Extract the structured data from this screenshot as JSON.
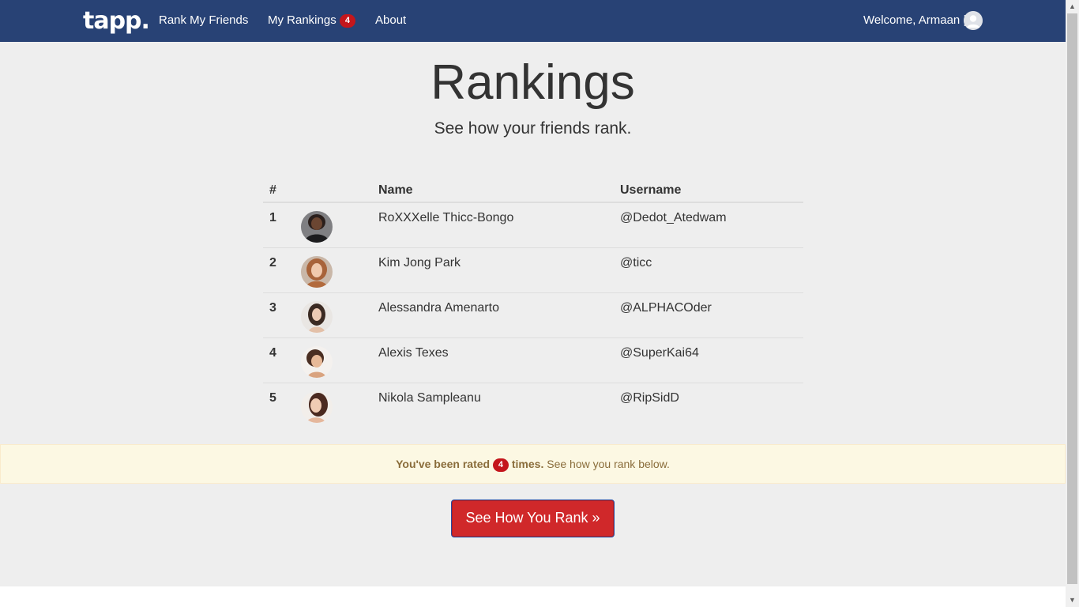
{
  "navbar": {
    "brand": "tapp.",
    "links": [
      {
        "label": "Rank My Friends"
      },
      {
        "label": "My Rankings",
        "badge": "4"
      },
      {
        "label": "About"
      }
    ],
    "welcome": "Welcome, Armaan |",
    "bg_color": "#284275"
  },
  "header": {
    "title": "Rankings",
    "subtitle": "See how your friends rank."
  },
  "table": {
    "columns": [
      "#",
      "",
      "Name",
      "Username"
    ],
    "rows": [
      {
        "rank": "1",
        "name": "RoXXXelle Thicc-Bongo",
        "username": "@Dedot_Atedwam"
      },
      {
        "rank": "2",
        "name": "Kim Jong Park",
        "username": "@ticc"
      },
      {
        "rank": "3",
        "name": "Alessandra Amenarto",
        "username": "@ALPHACOder"
      },
      {
        "rank": "4",
        "name": "Alexis Texes",
        "username": "@SuperKai64"
      },
      {
        "rank": "5",
        "name": "Nikola Sampleanu",
        "username": "@RipSidD"
      }
    ]
  },
  "alert": {
    "prefix": "You've been rated",
    "count": "4",
    "suffix": "times.",
    "rest": "See how you rank below."
  },
  "cta": {
    "label": "See How You Rank »",
    "color": "#d0282a"
  }
}
